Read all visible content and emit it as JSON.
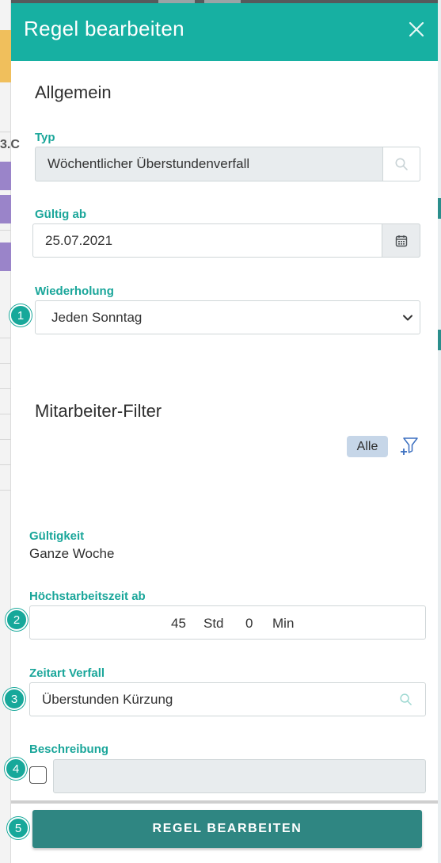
{
  "drawer": {
    "title": "Regel bearbeiten",
    "close_icon": "close-icon"
  },
  "background": {
    "left_fragment_text": "3.C"
  },
  "general": {
    "section_title": "Allgemein",
    "type": {
      "label": "Typ",
      "value": "Wöchentlicher Überstundenverfall",
      "icon": "search-icon"
    },
    "valid_from": {
      "label": "Gültig ab",
      "value": "25.07.2021",
      "icon": "calendar-icon"
    },
    "repeat": {
      "label": "Wiederholung",
      "value": "Jeden Sonntag",
      "step": "1",
      "icon": "chevron-down-icon"
    }
  },
  "employee_filter": {
    "section_title": "Mitarbeiter-Filter",
    "chip": "Alle",
    "icon": "add-filter-icon"
  },
  "validity": {
    "label": "Gültigkeit",
    "value": "Ganze Woche"
  },
  "max_work_time": {
    "label": "Höchstarbeitszeit ab",
    "step": "2",
    "hours": "45",
    "hours_unit": "Std",
    "minutes": "0",
    "minutes_unit": "Min"
  },
  "time_type": {
    "label": "Zeitart Verfall",
    "step": "3",
    "value": "Überstunden Kürzung",
    "icon": "search-icon"
  },
  "description": {
    "label": "Beschreibung",
    "step": "4",
    "value": ""
  },
  "submit": {
    "step": "5",
    "label": "REGEL BEARBEITEN"
  },
  "colors": {
    "accent": "#17b0a2",
    "button": "#2f8682",
    "label": "#1aa69a"
  }
}
